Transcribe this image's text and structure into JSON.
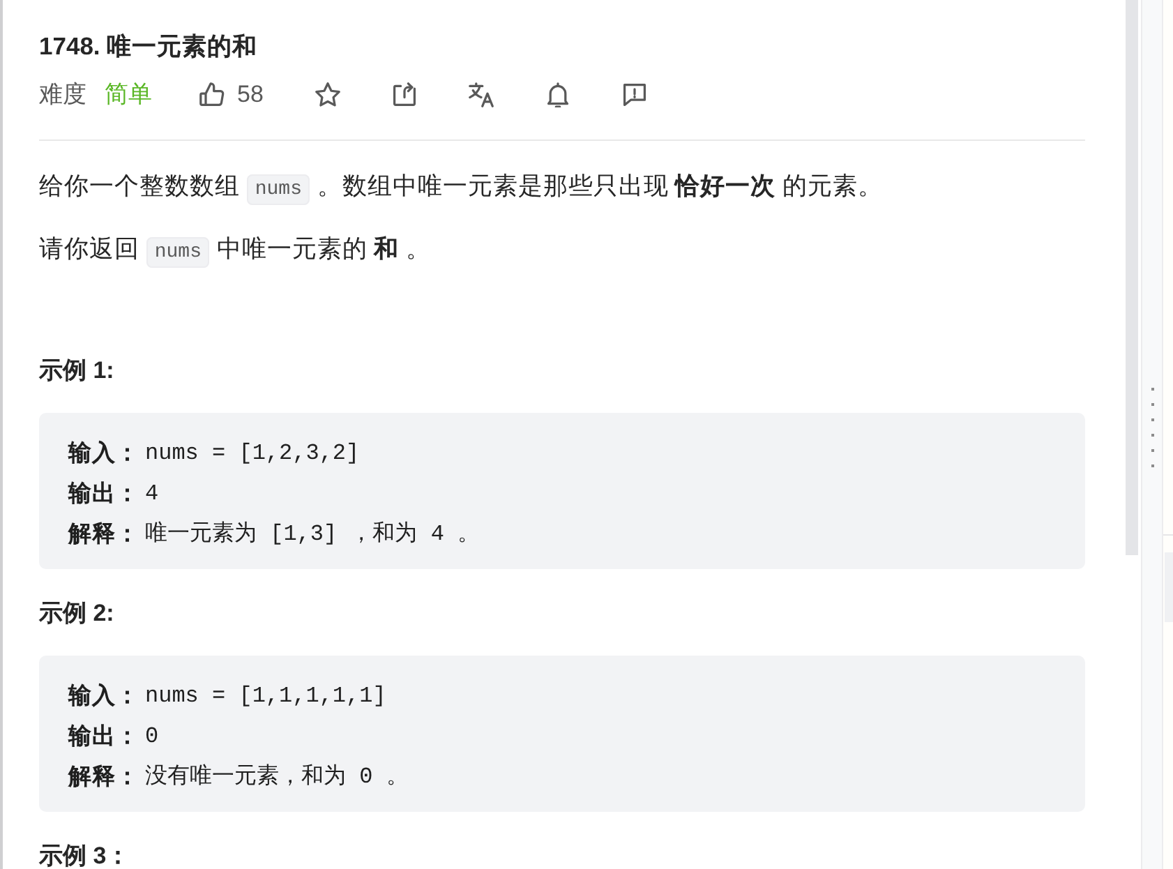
{
  "problem": {
    "title": "1748. 唯一元素的和",
    "difficulty_label": "难度",
    "difficulty": {
      "text": "简单",
      "kind": "easy"
    },
    "actions": [
      {
        "kind": "like",
        "count": "58"
      },
      {
        "kind": "favorite"
      },
      {
        "kind": "share"
      },
      {
        "kind": "translate"
      },
      {
        "kind": "subscribe"
      },
      {
        "kind": "feedback"
      }
    ]
  },
  "description": [
    {
      "segments": [
        {
          "kind": "text",
          "text": "给你一个整数数组 "
        },
        {
          "kind": "code",
          "text": "nums"
        },
        {
          "kind": "text",
          "text": " 。数组中唯一元素是那些只出现 **恰好一次** 的元素。"
        }
      ]
    },
    {
      "segments": [
        {
          "kind": "text",
          "text": "请你返回 "
        },
        {
          "kind": "code",
          "text": "nums"
        },
        {
          "kind": "text",
          "text": " 中唯一元素的 **和** 。"
        }
      ]
    }
  ],
  "examples": [
    {
      "title": "示例 1:",
      "lines": [
        {
          "label": "输入：",
          "value": "nums = [1,2,3,2]"
        },
        {
          "label": "输出：",
          "value": "4"
        },
        {
          "label": "解释：",
          "value": "唯一元素为 [1,3] ，和为 4 。"
        }
      ]
    },
    {
      "title": "示例 2:",
      "lines": [
        {
          "label": "输入：",
          "value": "nums = [1,1,1,1,1]"
        },
        {
          "label": "输出：",
          "value": "0"
        },
        {
          "label": "解释：",
          "value": "没有唯一元素，和为 0 。"
        }
      ]
    },
    {
      "title": "示例 3："
    }
  ]
}
